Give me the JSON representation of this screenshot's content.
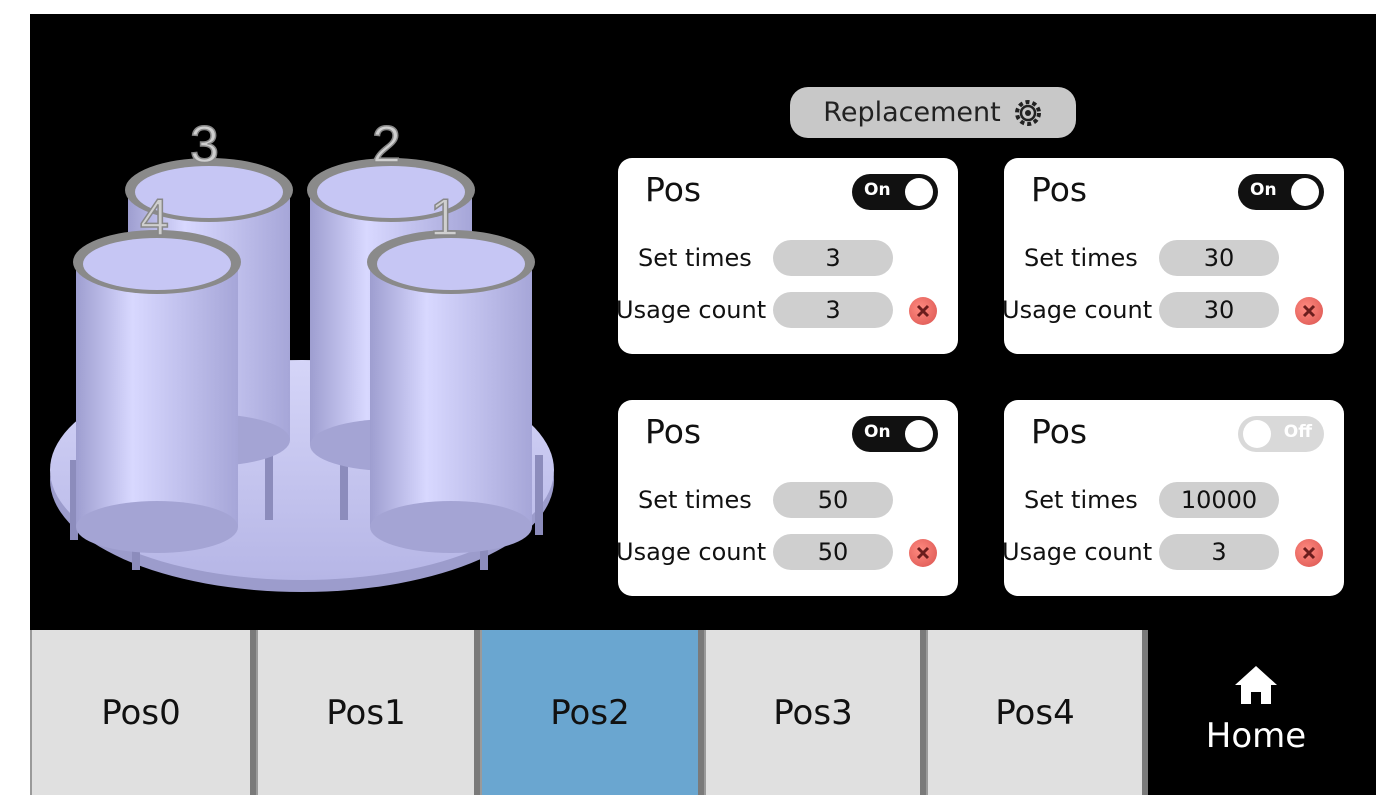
{
  "header": {
    "replacement_label": "Replacement"
  },
  "illustration": {
    "labels": [
      "1",
      "2",
      "3",
      "4"
    ]
  },
  "cards": [
    {
      "title": "Pos",
      "toggle": "On",
      "set_times_label": "Set times",
      "set_times": "3",
      "usage_label": "Usage count",
      "usage": "3"
    },
    {
      "title": "Pos",
      "toggle": "On",
      "set_times_label": "Set times",
      "set_times": "30",
      "usage_label": "Usage count",
      "usage": "30"
    },
    {
      "title": "Pos",
      "toggle": "On",
      "set_times_label": "Set times",
      "set_times": "50",
      "usage_label": "Usage count",
      "usage": "50"
    },
    {
      "title": "Pos",
      "toggle": "Off",
      "set_times_label": "Set times",
      "set_times": "10000",
      "usage_label": "Usage count",
      "usage": "3"
    }
  ],
  "nav": {
    "tabs": [
      "Pos0",
      "Pos1",
      "Pos2",
      "Pos3",
      "Pos4"
    ],
    "active": "Pos2",
    "home_label": "Home"
  },
  "colors": {
    "active_tab": "#6aa6d0",
    "tab": "#e0e0e0",
    "background": "#000000",
    "cylinder": "#c9c9f0",
    "reset": "#e0605a"
  },
  "icons": [
    "gear-icon",
    "close-icon",
    "home-icon"
  ]
}
